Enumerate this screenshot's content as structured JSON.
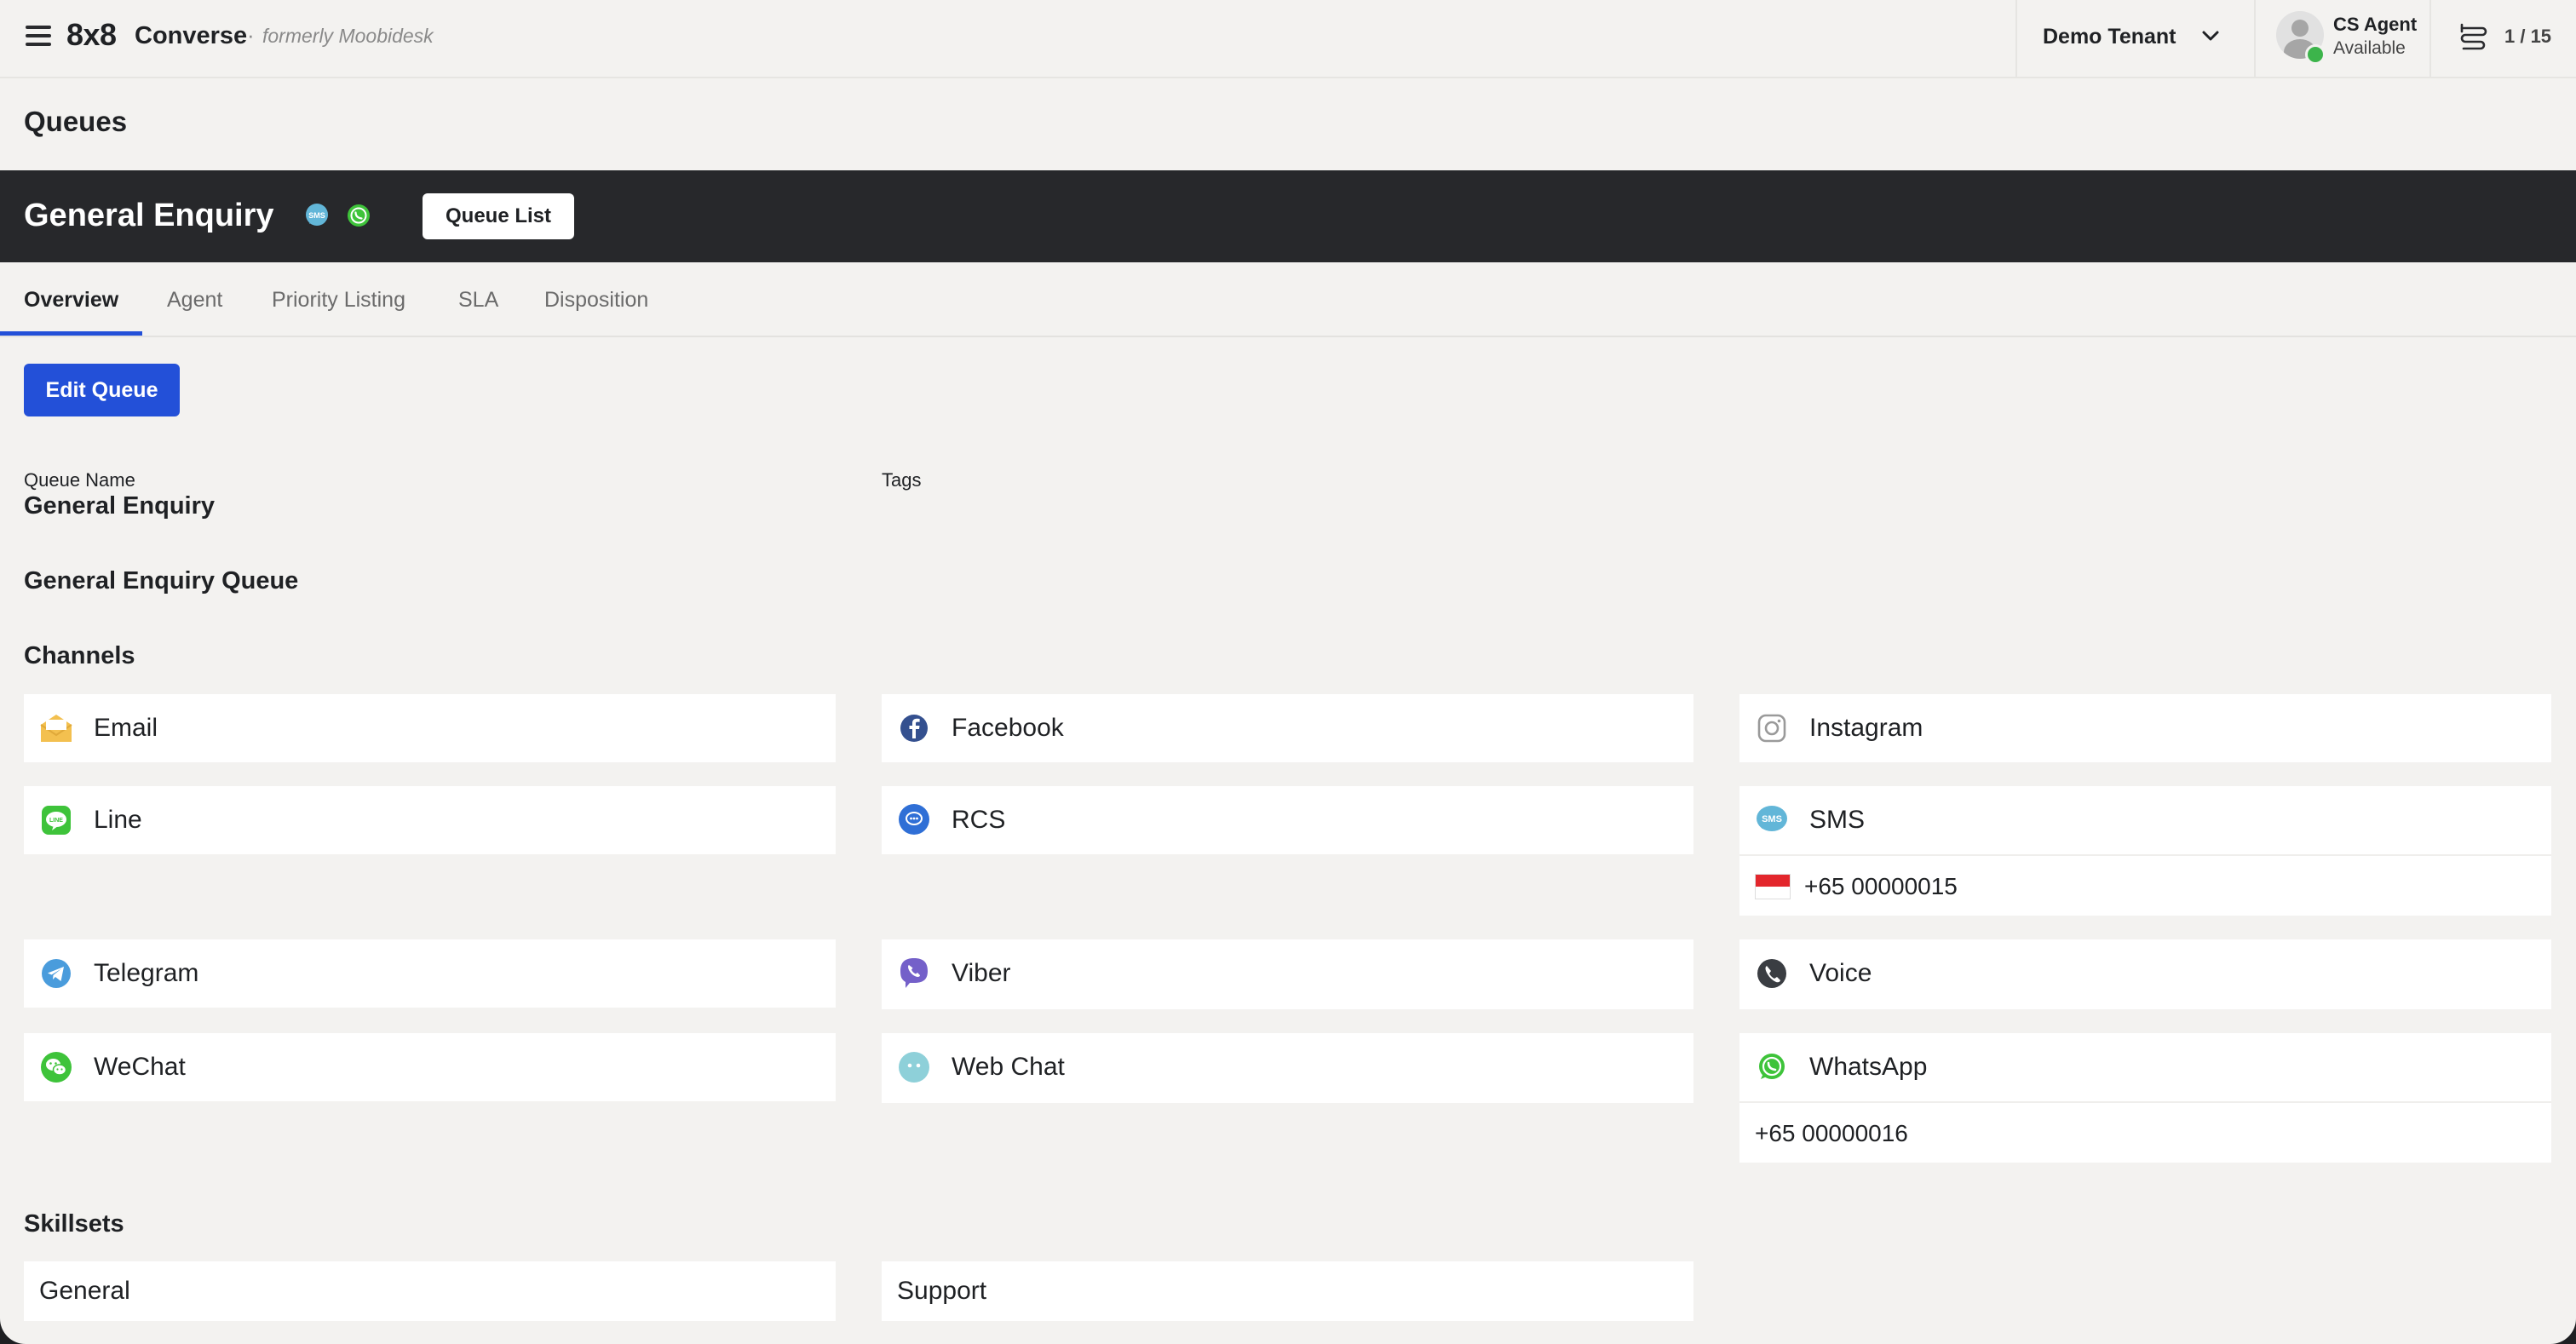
{
  "header": {
    "brand": "8x8",
    "product": "Converse",
    "separator": "·",
    "formerly": "formerly Moobidesk",
    "tenant": "Demo Tenant",
    "agent_name": "CS Agent",
    "agent_status": "Available",
    "counter": "1 / 15"
  },
  "page": {
    "title": "Queues"
  },
  "queue_header": {
    "title": "General Enquiry",
    "channel_icons": [
      "sms-icon",
      "whatsapp-icon"
    ],
    "queue_list_label": "Queue List"
  },
  "tabs": [
    {
      "label": "Overview",
      "active": true
    },
    {
      "label": "Agent",
      "active": false
    },
    {
      "label": "Priority Listing",
      "active": false
    },
    {
      "label": "SLA",
      "active": false
    },
    {
      "label": "Disposition",
      "active": false
    }
  ],
  "edit_button": "Edit Queue",
  "details": {
    "queue_name_label": "Queue Name",
    "queue_name": "General Enquiry",
    "tags_label": "Tags",
    "description": "General Enquiry Queue"
  },
  "channels": {
    "heading": "Channels",
    "items": [
      {
        "name": "Email",
        "icon": "email-icon",
        "color": "#f3c04f"
      },
      {
        "name": "Facebook",
        "icon": "facebook-icon",
        "color": "#34508f"
      },
      {
        "name": "Instagram",
        "icon": "instagram-icon",
        "color": "#9a9a9a"
      },
      {
        "name": "Line",
        "icon": "line-icon",
        "color": "#3ec33a"
      },
      {
        "name": "RCS",
        "icon": "rcs-icon",
        "color": "#2f6fd6"
      },
      {
        "name": "SMS",
        "icon": "sms-icon",
        "color": "#62b6d8",
        "number": "+65 00000015",
        "flag": "singapore-flag-icon"
      },
      {
        "name": "Telegram",
        "icon": "telegram-icon",
        "color": "#4a9cdc"
      },
      {
        "name": "Viber",
        "icon": "viber-icon",
        "color": "#7460c9"
      },
      {
        "name": "Voice",
        "icon": "phone-icon",
        "color": "#3a3d42"
      },
      {
        "name": "WeChat",
        "icon": "wechat-icon",
        "color": "#3ec33a"
      },
      {
        "name": "Web Chat",
        "icon": "webchat-icon",
        "color": "#8ed0d9"
      },
      {
        "name": "WhatsApp",
        "icon": "whatsapp-icon",
        "color": "#3ec33a",
        "number": "+65 00000016"
      }
    ]
  },
  "skillsets": {
    "heading": "Skillsets",
    "items": [
      "General",
      "Support"
    ]
  },
  "colors": {
    "accent": "#2350d8",
    "header_dark": "#27282b",
    "background": "#f3f2f0",
    "available": "#3cb44b"
  }
}
